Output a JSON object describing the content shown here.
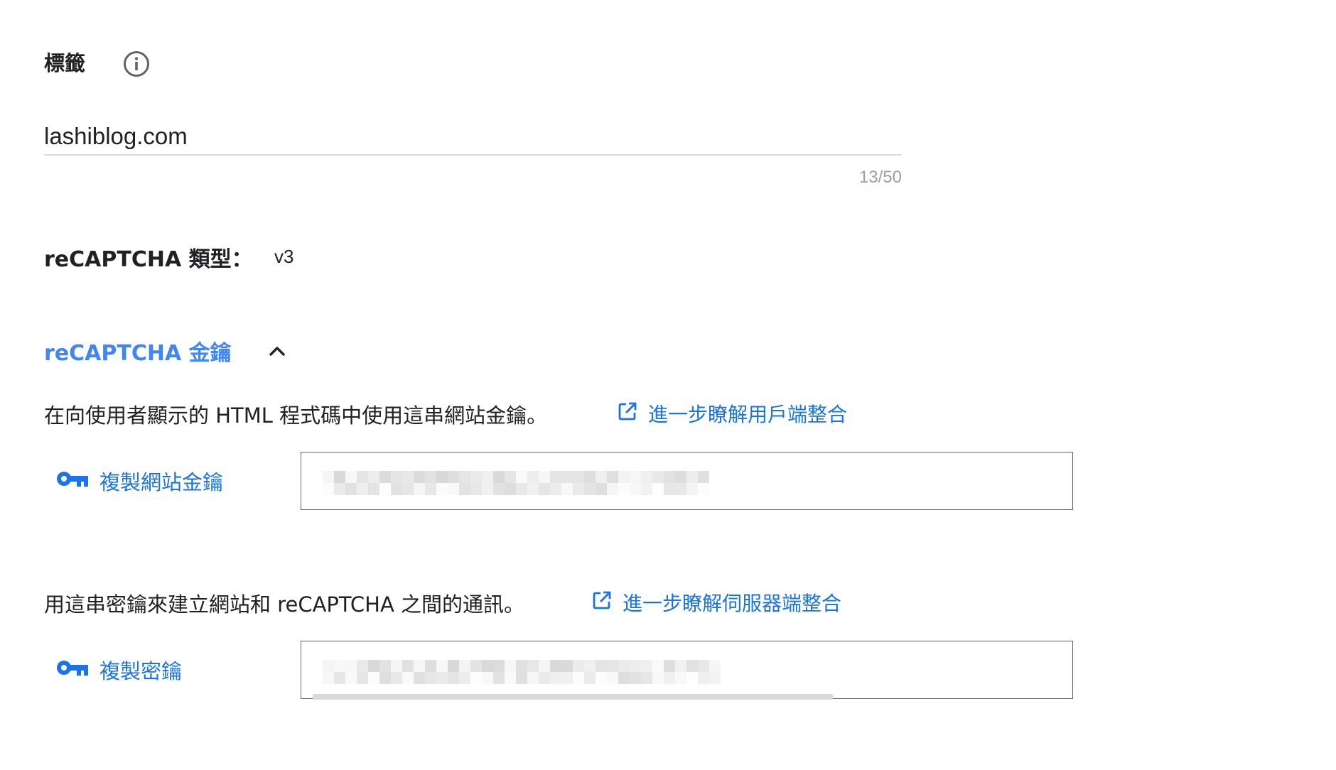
{
  "label_section": {
    "title": "標籤",
    "info_icon": "info-icon",
    "input_value": "lashiblog.com",
    "char_count": "13/50"
  },
  "type_section": {
    "label": "reCAPTCHA 類型：",
    "value": "v3"
  },
  "keys_section": {
    "header": "reCAPTCHA 金鑰",
    "expand_icon": "chevron-up-icon",
    "site_key": {
      "description": "在向使用者顯示的 HTML 程式碼中使用這串網站金鑰。",
      "learn_more": "進一步瞭解用戶端整合",
      "copy_label": "複製網站金鑰",
      "value_redacted": true
    },
    "secret_key": {
      "description": "用這串密鑰來建立網站和 reCAPTCHA 之間的通訊。",
      "learn_more": "進一步瞭解伺服器端整合",
      "copy_label": "複製密鑰",
      "value_redacted": true
    }
  },
  "colors": {
    "accent": "#1a73e8",
    "header_blue": "#4285f4",
    "text": "#202124",
    "muted": "#9aa0a6",
    "border": "#5f6368"
  }
}
